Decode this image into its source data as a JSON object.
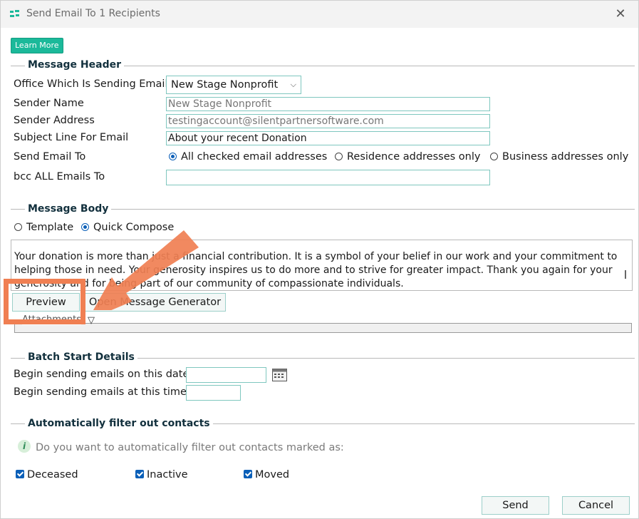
{
  "window": {
    "title": "Send Email To 1 Recipients",
    "close_glyph": "✕"
  },
  "learn_more": "Learn More",
  "header": {
    "section_title": "Message Header",
    "office_label": "Office Which Is Sending Email",
    "office_value": "New Stage Nonprofit",
    "sender_name_label": "Sender Name",
    "sender_name_value": "New Stage Nonprofit",
    "sender_address_label": "Sender Address",
    "sender_address_value": "testingaccount@silentpartnersoftware.com",
    "subject_label": "Subject Line For Email",
    "subject_value": "About your recent Donation",
    "send_to_label": "Send Email To",
    "send_to_options": [
      "All checked email addresses",
      "Residence addresses only",
      "Business addresses only"
    ],
    "send_to_selected": 0,
    "bcc_label": "bcc ALL Emails To",
    "bcc_value": ""
  },
  "body": {
    "section_title": "Message Body",
    "mode_options": [
      "Template",
      "Quick Compose"
    ],
    "mode_selected": 1,
    "text_line1": "Your donation is more than just a financial contribution. It is a symbol of your belief in our work and your commitment to",
    "text_line2": "helping those in need. Your generosity inspires us to do more and to strive for greater impact. Thank you again for your",
    "text_line3": "generosity and for being part of our community of compassionate individuals.",
    "preview_button": "Preview",
    "generator_button": "Open Message Generator",
    "attachments_label": "Attachments"
  },
  "batch": {
    "section_title": "Batch Start Details",
    "date_label": "Begin sending emails on this date",
    "date_value": "",
    "time_label": "Begin sending emails at this time",
    "time_value": ""
  },
  "filter": {
    "section_title": "Automatically filter out contacts",
    "question": "Do you want to automatically filter out contacts marked as:",
    "options": [
      "Deceased",
      "Inactive",
      "Moved"
    ]
  },
  "footer": {
    "send_button": "Send",
    "cancel_button": "Cancel"
  },
  "colors": {
    "accent": "#1bb99a",
    "highlight": "#f07f52",
    "check": "#0a5fb8"
  },
  "icons": [
    "app-logo-icon",
    "close-icon",
    "chevron-down-icon",
    "calendar-icon",
    "info-icon",
    "arrow-annotation-icon"
  ]
}
